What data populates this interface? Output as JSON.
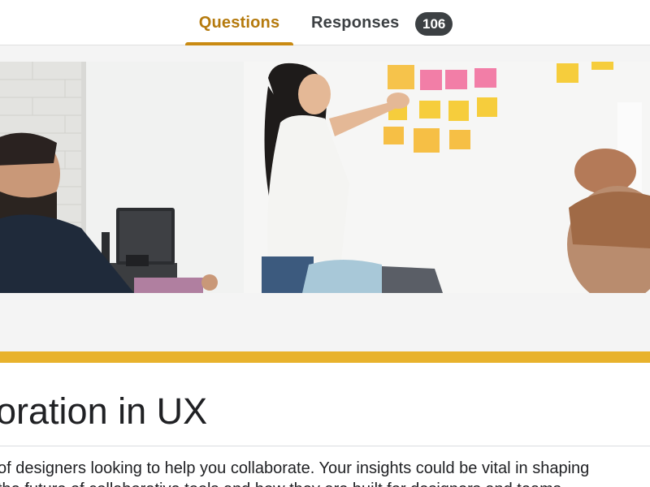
{
  "tabs": {
    "questions_label": "Questions",
    "responses_label": "Responses",
    "responses_count": "106"
  },
  "theme": {
    "accent": "#e8b22c",
    "tab_active": "#b57a0d",
    "header_bg": "#f4f4f4"
  },
  "header_image": {
    "description_icon": "photo-banner"
  },
  "form": {
    "title": "oration in UX",
    "description": "of designers looking to help you collaborate. Your insights could be vital in shaping",
    "description_line2": "the future of collaborative tools and how they are built for designers and teams."
  }
}
